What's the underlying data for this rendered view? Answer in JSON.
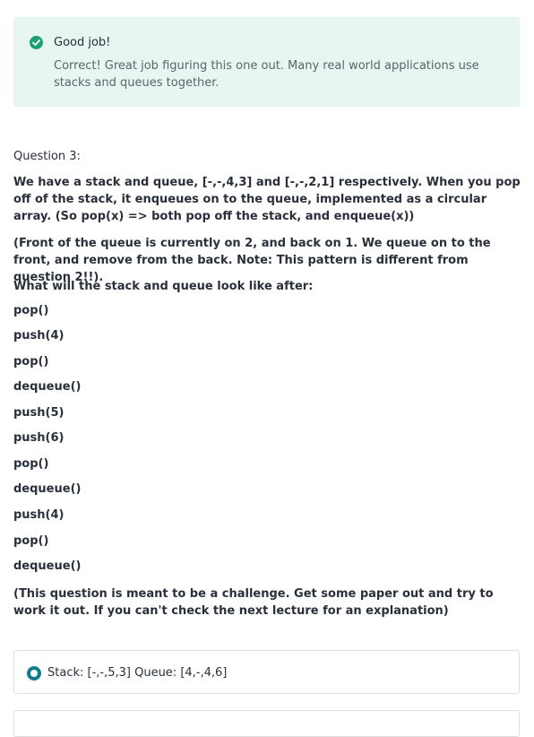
{
  "feedback": {
    "title": "Good job!",
    "body": "Correct! Great job figuring this one out. Many real world applications use stacks and queues together.",
    "icon": "check-circle-icon",
    "color": "#1d9e76"
  },
  "question": {
    "label": "Question 3:",
    "paragraph1": "We have a stack and queue, [-,-,4,3] and [-,-,2,1] respectively. When you pop off of the stack, it enqueues on to the queue, implemented as a circular array. (So pop(x) => both pop off the stack, and enqueue(x))",
    "paragraph2_text": "(Front of the queue is currently on 2, and back on 1. We queue on to the front, and remove from the back. ",
    "paragraph2_bold": "Note: This pattern is different from question 2!!",
    "paragraph2_end": ").",
    "prompt": "What will the stack and queue look like after:",
    "operations": [
      "pop()",
      "push(4)",
      "pop()",
      "dequeue()",
      "push(5)",
      "push(6)",
      "pop()",
      "dequeue()",
      "push(4)",
      "pop()",
      "dequeue()"
    ],
    "note": "(This question is meant to be a challenge. Get some paper out and try to work it out. If you can't check the next lecture for an explanation)"
  },
  "answers": [
    {
      "label": "Stack: [-,-,5,3] Queue: [4,-,4,6]",
      "selected": true
    }
  ],
  "colors": {
    "accent": "#0f7c90",
    "success_bg": "#e8f6f1"
  }
}
